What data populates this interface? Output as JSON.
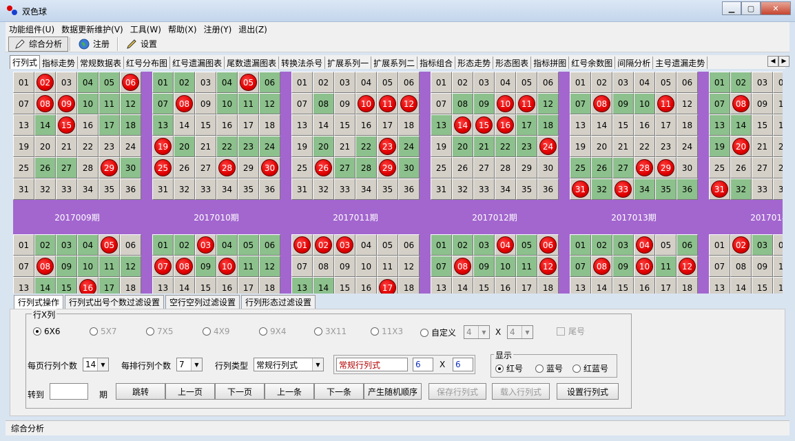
{
  "window": {
    "title": "双色球"
  },
  "menu": [
    "功能组件(U)",
    "数据更新维护(V)",
    "工具(W)",
    "帮助(X)",
    "注册(Y)",
    "退出(Z)"
  ],
  "toolbar": {
    "analysis": "综合分析",
    "register": "注册",
    "settings": "设置"
  },
  "tabs": [
    "行列式",
    "指标走势",
    "常规数据表",
    "红号分布图",
    "红号遗漏图表",
    "尾数遗漏图表",
    "转换法杀号",
    "扩展系列一",
    "扩展系列二",
    "指标组合",
    "形态走势",
    "形态图表",
    "指标拼图",
    "红号余数图",
    "间隔分析",
    "主号遗漏走势"
  ],
  "colors": {
    "green": "#8cc08c",
    "red_ball": "#e00000",
    "band": "#a366cf"
  },
  "periods": [
    "2017009期",
    "2017010期",
    "2017011期",
    "2017012期",
    "2017013期",
    "2017014期"
  ],
  "top_grids": [
    {
      "red": [
        2,
        6,
        8,
        9,
        15,
        29
      ],
      "green": [
        4,
        5,
        10,
        11,
        12,
        14,
        17,
        18,
        26,
        27,
        30
      ]
    },
    {
      "red": [
        5,
        8,
        19,
        25,
        28,
        30
      ],
      "green": [
        1,
        2,
        4,
        6,
        7,
        10,
        11,
        12,
        13,
        20,
        22,
        23,
        24
      ]
    },
    {
      "red": [
        10,
        11,
        12,
        23,
        26,
        29
      ],
      "green": [
        8,
        20,
        22,
        24,
        27,
        28,
        30
      ]
    },
    {
      "red": [
        10,
        11,
        14,
        15,
        16,
        24
      ],
      "green": [
        8,
        9,
        12,
        13,
        17,
        18,
        20,
        21,
        22,
        23
      ]
    },
    {
      "red": [
        8,
        11,
        28,
        29,
        31,
        33
      ],
      "green": [
        7,
        9,
        10,
        25,
        26,
        27,
        32,
        34,
        35,
        36
      ]
    },
    {
      "red": [
        8,
        20,
        31
      ],
      "green": [
        1,
        2,
        7,
        13,
        14,
        19,
        32
      ]
    }
  ],
  "bottom_grids": [
    {
      "red": [
        5,
        8,
        16
      ],
      "green": [
        2,
        3,
        4,
        9,
        10,
        11,
        12,
        14,
        15,
        17
      ]
    },
    {
      "red": [
        3,
        7,
        8,
        10
      ],
      "green": [
        1,
        2,
        4,
        5,
        6,
        9,
        11,
        12
      ]
    },
    {
      "red": [
        1,
        2,
        3,
        17
      ],
      "green": [
        13,
        14
      ]
    },
    {
      "red": [
        4,
        6,
        8,
        12
      ],
      "green": [
        1,
        2,
        3,
        5,
        7,
        9,
        10,
        11
      ]
    },
    {
      "red": [
        4,
        8,
        10,
        12
      ],
      "green": [
        1,
        2,
        3,
        6,
        7,
        9,
        11
      ]
    },
    {
      "red": [
        2,
        12
      ],
      "green": [
        3
      ]
    }
  ],
  "subtabs": [
    "行列式操作",
    "行列式出号个数过滤设置",
    "空行空列过滤设置",
    "行列形态过滤设置"
  ],
  "rowcol": {
    "group_title": "行X列",
    "options": [
      "6X6",
      "5X7",
      "7X5",
      "4X9",
      "9X4",
      "3X11",
      "11X3",
      "自定义"
    ],
    "custom_a": "4",
    "custom_b": "4",
    "times": "X",
    "tail_label": "尾号"
  },
  "per_page": {
    "label": "每页行列个数",
    "value": "14"
  },
  "per_row": {
    "label": "每排行列个数",
    "value": "7"
  },
  "type": {
    "label": "行列类型",
    "value": "常规行列式"
  },
  "type_detail": {
    "name": "常规行列式",
    "rows": "6",
    "times": "X",
    "cols": "6"
  },
  "display": {
    "title": "显示",
    "options": [
      "红号",
      "蓝号",
      "红蓝号"
    ]
  },
  "goto": {
    "label": "转到",
    "suffix": "期",
    "value": ""
  },
  "buttons": {
    "jump": "跳转",
    "prev_page": "上一页",
    "next_page": "下一页",
    "prev_item": "上一条",
    "next_item": "下一条",
    "random": "产生随机顺序",
    "save": "保存行列式",
    "load": "载入行列式",
    "set": "设置行列式"
  },
  "status": "综合分析"
}
